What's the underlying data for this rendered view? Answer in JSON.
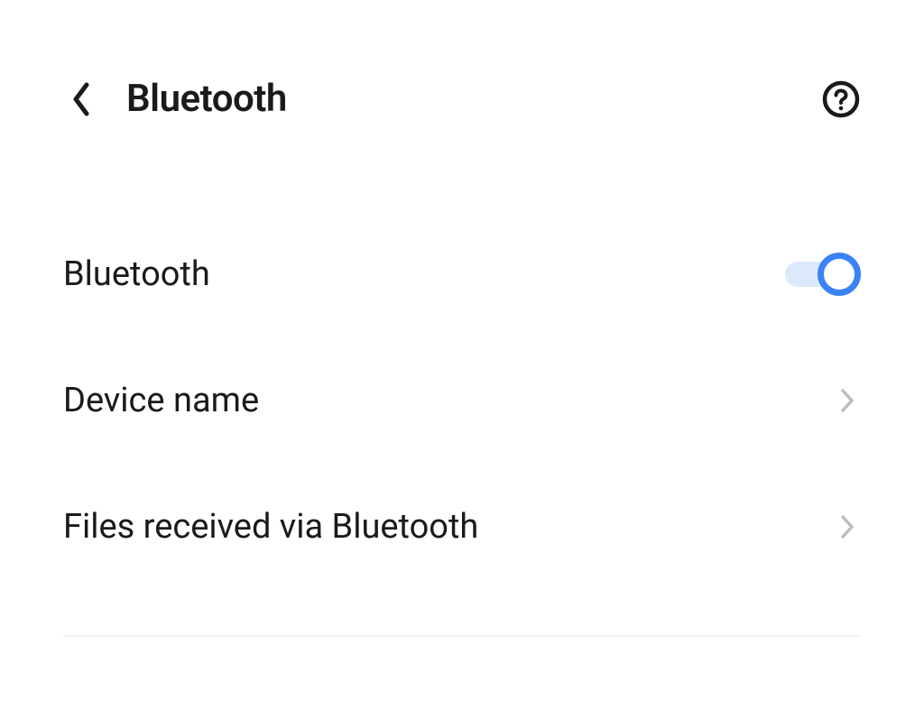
{
  "header": {
    "title": "Bluetooth"
  },
  "rows": {
    "bluetooth": {
      "label": "Bluetooth",
      "toggle_on": true
    },
    "device_name": {
      "label": "Device name"
    },
    "files_received": {
      "label": "Files received via Bluetooth"
    }
  },
  "colors": {
    "accent": "#3b82f6",
    "track": "#dbe9fb",
    "text": "#1a1a1a",
    "divider": "#f1f1f1",
    "chevron": "#bdbdbd"
  }
}
